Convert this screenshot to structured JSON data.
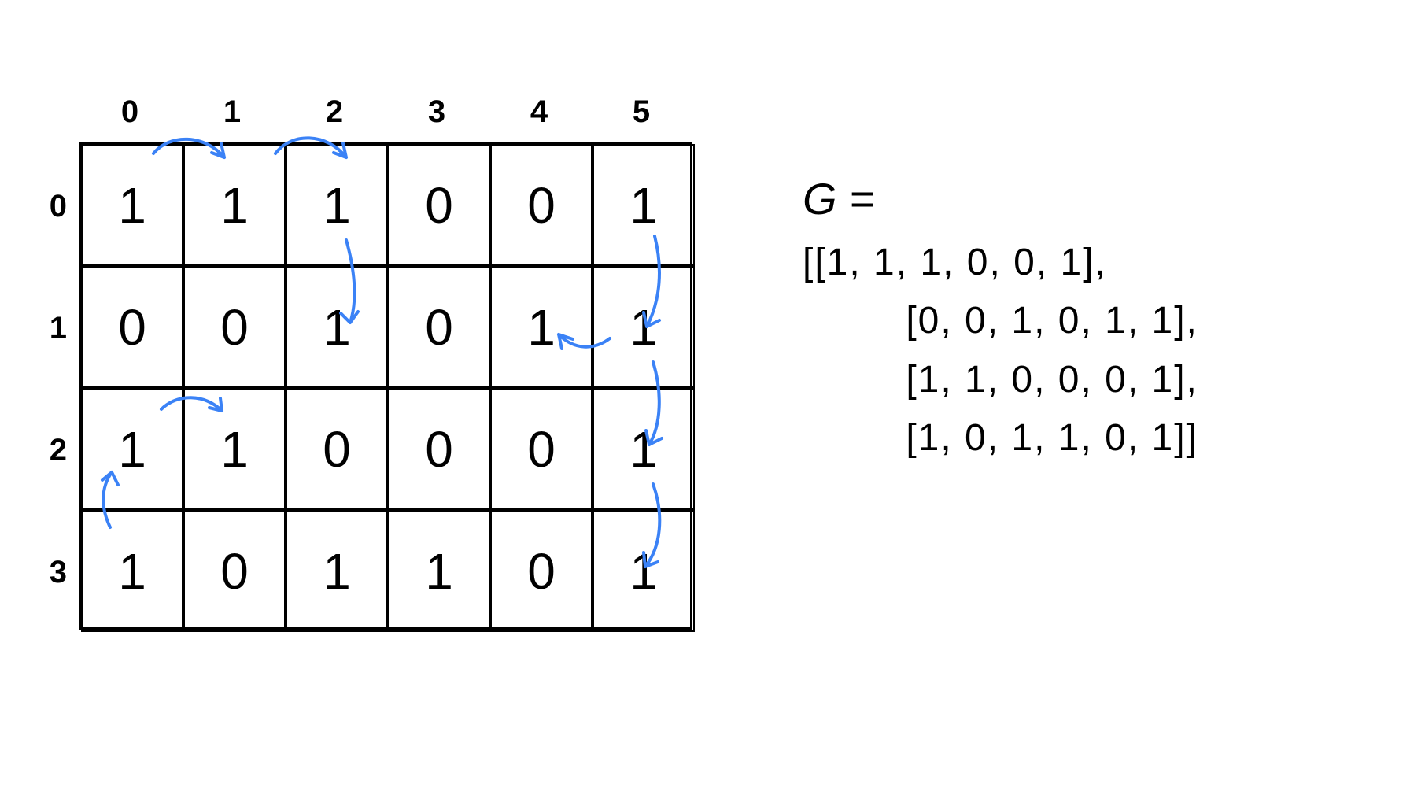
{
  "grid": {
    "col_headers": [
      "0",
      "1",
      "2",
      "3",
      "4",
      "5"
    ],
    "row_headers": [
      "0",
      "1",
      "2",
      "3"
    ],
    "cells": [
      [
        "1",
        "1",
        "1",
        "0",
        "0",
        "1"
      ],
      [
        "0",
        "0",
        "1",
        "0",
        "1",
        "1"
      ],
      [
        "1",
        "1",
        "0",
        "0",
        "0",
        "1"
      ],
      [
        "1",
        "0",
        "1",
        "1",
        "0",
        "1"
      ]
    ]
  },
  "matrix": {
    "lhs": "G = ",
    "rows": [
      "[[1, 1, 1, 0, 0, 1],",
      " [0, 0, 1, 0, 1, 1],",
      " [1, 1, 0, 0, 0, 1],",
      " [1, 0, 1, 1, 0, 1]]"
    ]
  },
  "arrows_note": "blue handwritten arrows linking adjacent 1-cells"
}
